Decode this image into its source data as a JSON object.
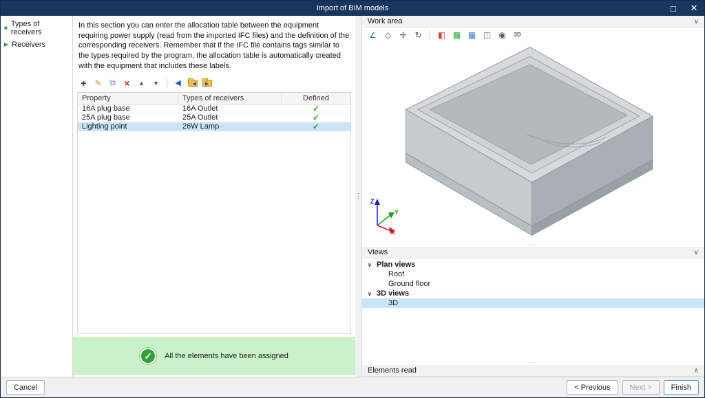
{
  "window": {
    "title": "Import of BIM models"
  },
  "glyphs": {
    "maximize": "□",
    "close": "✕",
    "chevron_down": "∨",
    "chevron_up": "∧",
    "dots_h": "···",
    "dots_v": "⋮",
    "bullet_square": "■",
    "bullet_arrow": "▶",
    "check": "✓"
  },
  "icons": {
    "add": "+",
    "edit": "✎",
    "copy": "⧉",
    "delete": "×",
    "move_up": "▲",
    "move_down": "▼",
    "assign": "◀"
  },
  "wa_icons": {
    "measure": "∠",
    "view_cube": "◇",
    "pan": "✛",
    "orbit": "↻",
    "section": "◧",
    "grid": "▩",
    "table": "▦",
    "model": "◫",
    "eye": "◉",
    "mode3d": "3D"
  },
  "sidebar": {
    "items": [
      {
        "label": "Types of receivers"
      },
      {
        "label": "Receivers"
      }
    ]
  },
  "main": {
    "description": "In this section you can enter the allocation table between the equipment requiring power supply (read from the imported IFC files) and the definition of the corresponding receivers. Remember that if the IFC file contains tags similar to the types required by the program, the allocation table is automatically created with the equipment that includes these labels.",
    "table": {
      "columns": [
        "Property",
        "Types of receivers",
        "Defined"
      ],
      "rows": [
        {
          "property": "16A plug base",
          "type": "16A Outlet"
        },
        {
          "property": "25A plug base",
          "type": "25A Outlet"
        },
        {
          "property": "Lighting point",
          "type": "26W Lamp"
        }
      ]
    },
    "status": "All the elements have been assigned"
  },
  "right": {
    "work_area": {
      "title": "Work area"
    },
    "views": {
      "title": "Views",
      "tree": [
        {
          "label": "Plan views",
          "children": [
            "Roof",
            "Ground floor"
          ]
        },
        {
          "label": "3D views",
          "children": [
            "3D"
          ]
        }
      ]
    },
    "elements_read": {
      "title": "Elements read"
    }
  },
  "axes": {
    "x": "X",
    "y": "Y",
    "z": "Z"
  },
  "footer": {
    "cancel": "Cancel",
    "previous": "< Previous",
    "next": "Next >",
    "finish": "Finish"
  }
}
